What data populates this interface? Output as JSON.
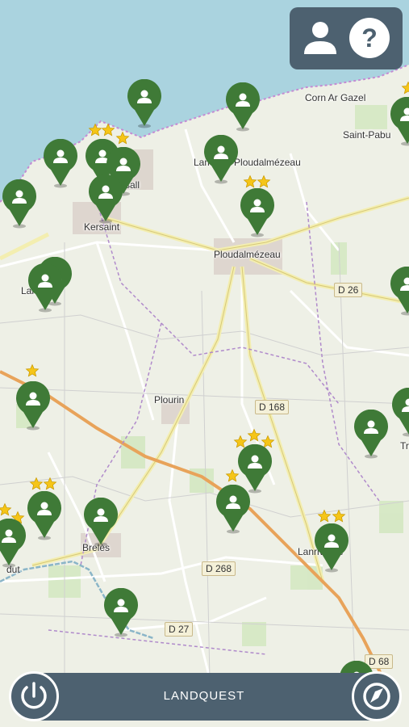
{
  "app": {
    "title": "LANDQUEST"
  },
  "places": [
    {
      "name": "Corn Ar Gazel"
    },
    {
      "name": "Saint-Pabu"
    },
    {
      "name": "Lampaul-Ploudalmézeau"
    },
    {
      "name": "Kersaint"
    },
    {
      "name": "Ploudalmézeau"
    },
    {
      "name": "Lanrivez"
    },
    {
      "name": "Plourin"
    },
    {
      "name": "Brelès"
    },
    {
      "name": "Lanrivoaré"
    },
    {
      "name": "sall"
    },
    {
      "name": "Tr"
    },
    {
      "name": "dut"
    }
  ],
  "roads": [
    "D 26",
    "D 168",
    "D 268",
    "D 27",
    "D 68"
  ],
  "top_buttons": {
    "profile_icon": "person-icon",
    "help_icon": "help-icon"
  },
  "bottom_buttons": {
    "power_icon": "power-icon",
    "compass_icon": "compass-icon"
  },
  "colors": {
    "pin": "#3f7a37",
    "star": "#f5c518",
    "bar": "#4d6170",
    "sea": "#aad3df",
    "land": "#eef0e6"
  }
}
